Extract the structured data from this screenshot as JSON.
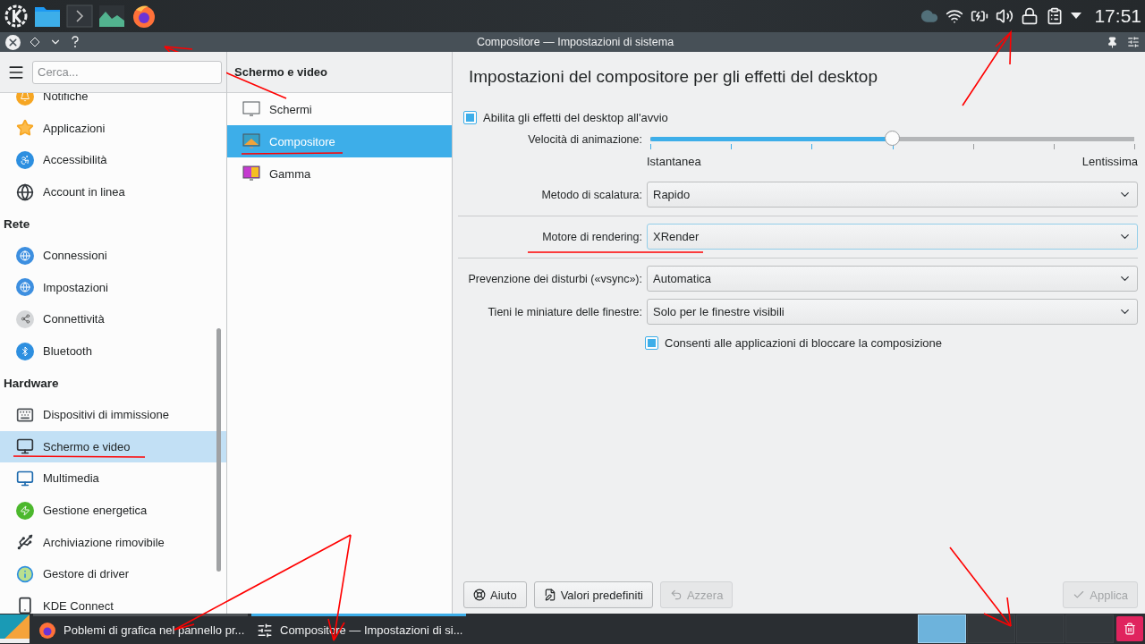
{
  "top_panel": {
    "clock": "17:51"
  },
  "window": {
    "title": "Compositore — Impostazioni di sistema"
  },
  "sidebar": {
    "search": {
      "placeholder": "Cerca..."
    },
    "groups": [
      {
        "items": [
          {
            "label": "Notifiche",
            "selected": false
          },
          {
            "label": "Applicazioni",
            "selected": false
          },
          {
            "label": "Accessibilità",
            "selected": false
          },
          {
            "label": "Account in linea",
            "selected": false
          }
        ]
      },
      {
        "title": "Rete",
        "items": [
          {
            "label": "Connessioni",
            "selected": false
          },
          {
            "label": "Impostazioni",
            "selected": false
          },
          {
            "label": "Connettività",
            "selected": false
          },
          {
            "label": "Bluetooth",
            "selected": false
          }
        ]
      },
      {
        "title": "Hardware",
        "items": [
          {
            "label": "Dispositivi di immissione",
            "selected": false
          },
          {
            "label": "Schermo e video",
            "selected": true
          },
          {
            "label": "Multimedia",
            "selected": false
          },
          {
            "label": "Gestione energetica",
            "selected": false
          },
          {
            "label": "Archiviazione rimovibile",
            "selected": false
          },
          {
            "label": "Gestore di driver",
            "selected": false
          },
          {
            "label": "KDE Connect",
            "selected": false
          }
        ]
      }
    ]
  },
  "category": {
    "title": "Schermo e video",
    "items": [
      {
        "label": "Schermi",
        "selected": false
      },
      {
        "label": "Compositore",
        "selected": true
      },
      {
        "label": "Gamma",
        "selected": false
      }
    ]
  },
  "page": {
    "heading": "Impostazioni del compositore per gli effetti del desktop",
    "enable_effects": {
      "label": "Abilita gli effetti del desktop all'avvio",
      "checked": true
    },
    "animation_speed": {
      "label": "Velocità di animazione:",
      "level": 0.5,
      "min_label": "Istantanea",
      "max_label": "Lentissima"
    },
    "setting_groups": [
      {
        "rows": [
          {
            "label": "Metodo di scalatura:",
            "value": "Rapido",
            "highlighted": false
          }
        ]
      },
      {
        "rows": [
          {
            "label": "Motore di rendering:",
            "value": "XRender",
            "highlighted": true
          }
        ]
      },
      {
        "rows": [
          {
            "label": "Prevenzione dei disturbi («vsync»):",
            "value": "Automatica",
            "highlighted": false
          },
          {
            "label": "Tieni le miniature delle finestre:",
            "value": "Solo per le finestre visibili",
            "highlighted": false
          }
        ]
      }
    ],
    "allow_block": {
      "label": "Consenti alle applicazioni di bloccare la composizione",
      "checked": true
    },
    "buttons": [
      {
        "label": "Aiuto",
        "disabled": false
      },
      {
        "label": "Valori predefiniti",
        "disabled": false
      },
      {
        "label": "Azzera",
        "disabled": true
      }
    ],
    "apply_button": {
      "label": "Applica",
      "disabled": true
    }
  },
  "taskbar": {
    "tasks": [
      {
        "label": "Poblemi di grafica nel pannello pr...",
        "selected": false
      },
      {
        "label": "Compositore — Impostazioni di si...",
        "selected": true
      }
    ],
    "desktops": [
      {
        "selected": true
      },
      {
        "selected": false
      },
      {
        "selected": false
      },
      {
        "selected": false
      }
    ]
  }
}
